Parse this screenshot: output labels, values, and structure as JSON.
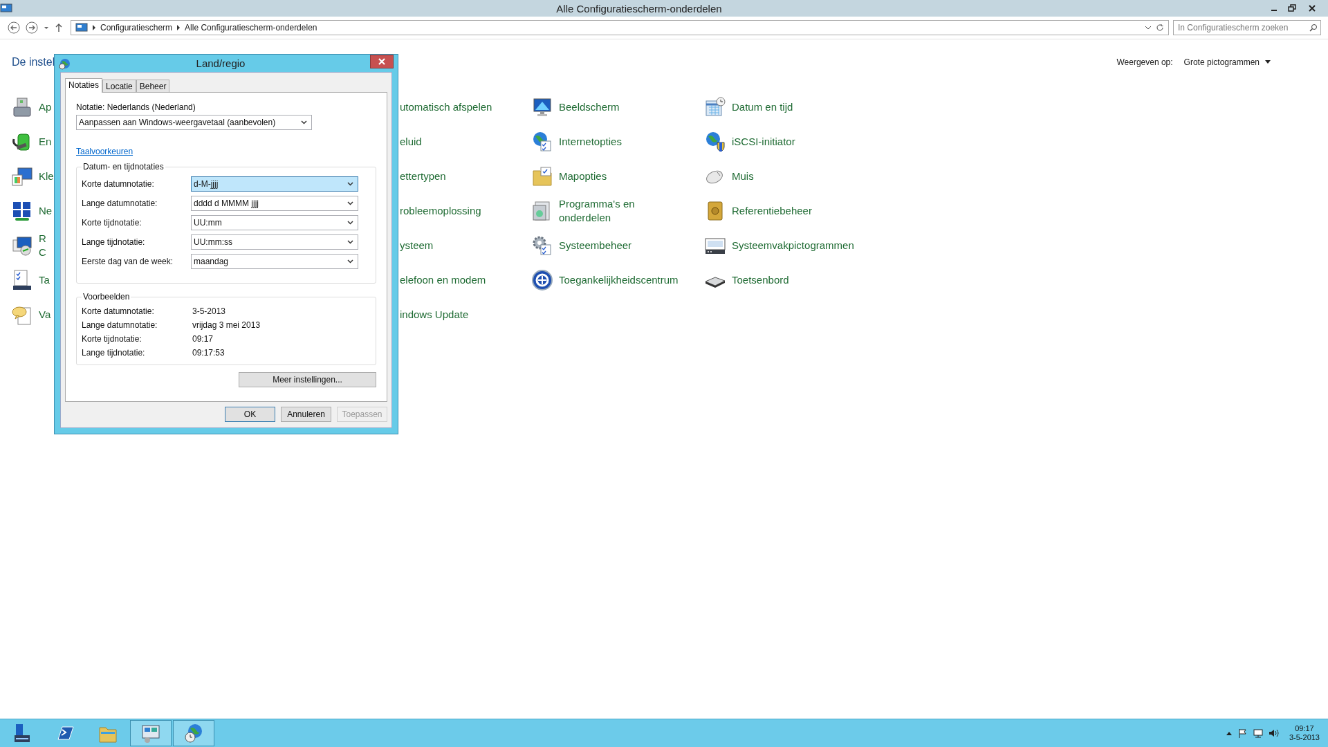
{
  "window": {
    "title": "Alle Configuratiescherm-onderdelen"
  },
  "address_bar": {
    "breadcrumbs": [
      "Configuratiescherm",
      "Alle Configuratiescherm-onderdelen"
    ]
  },
  "search": {
    "placeholder": "In Configuratiescherm zoeken"
  },
  "heading": "De instel",
  "view_by": {
    "label": "Weergeven op:",
    "value": "Grote pictogrammen"
  },
  "columns": [
    {
      "items": [
        {
          "kind": "icon",
          "lines": [
            "Ap"
          ]
        },
        {
          "kind": "icon",
          "lines": [
            "En"
          ]
        },
        {
          "kind": "icon",
          "lines": [
            "Kle"
          ]
        },
        {
          "kind": "icon",
          "lines": [
            "Ne"
          ]
        },
        {
          "kind": "icon",
          "lines": [
            "R",
            "C"
          ]
        },
        {
          "kind": "icon",
          "lines": [
            "Ta"
          ]
        },
        {
          "kind": "icon",
          "lines": [
            "Va"
          ]
        }
      ]
    },
    {
      "items": [
        {
          "kind": "text",
          "lines": [
            "utomatisch afspelen"
          ]
        },
        {
          "kind": "text",
          "lines": [
            "eluid"
          ]
        },
        {
          "kind": "text",
          "lines": [
            "ettertypen"
          ]
        },
        {
          "kind": "text",
          "lines": [
            "robleemoplossing"
          ]
        },
        {
          "kind": "text",
          "lines": [
            "ysteem"
          ]
        },
        {
          "kind": "text",
          "lines": [
            "elefoon en modem"
          ]
        },
        {
          "kind": "text",
          "lines": [
            "indows Update"
          ]
        }
      ]
    },
    {
      "items": [
        {
          "kind": "icon",
          "lines": [
            "Beeldscherm"
          ]
        },
        {
          "kind": "icon",
          "lines": [
            "Internetopties"
          ]
        },
        {
          "kind": "icon",
          "lines": [
            "Mapopties"
          ]
        },
        {
          "kind": "icon",
          "lines": [
            "Programma's en",
            "onderdelen"
          ]
        },
        {
          "kind": "icon",
          "lines": [
            "Systeembeheer"
          ]
        },
        {
          "kind": "icon",
          "lines": [
            "Toegankelijkheidscentrum"
          ]
        }
      ]
    },
    {
      "items": [
        {
          "kind": "icon",
          "lines": [
            "Datum en tijd"
          ]
        },
        {
          "kind": "icon",
          "lines": [
            "iSCSI-initiator"
          ]
        },
        {
          "kind": "icon",
          "lines": [
            "Muis"
          ]
        },
        {
          "kind": "icon",
          "lines": [
            "Referentiebeheer"
          ]
        },
        {
          "kind": "icon",
          "lines": [
            "Systeemvakpictogrammen"
          ]
        },
        {
          "kind": "icon",
          "lines": [
            "Toetsenbord"
          ]
        }
      ]
    }
  ],
  "dialog": {
    "title": "Land/regio",
    "tabs": [
      {
        "label": "Notaties",
        "selected": true
      },
      {
        "label": "Locatie",
        "selected": false
      },
      {
        "label": "Beheer",
        "selected": false
      }
    ],
    "format_label": "Notatie: Nederlands (Nederland)",
    "format_value": "Aanpassen aan Windows-weergavetaal (aanbevolen)",
    "link": "Taalvoorkeuren",
    "formats_group": {
      "title": "Datum- en tijdnotaties",
      "fields": [
        {
          "label": "Korte datumnotatie:",
          "value": "d-M-jjjj",
          "highlighted": true
        },
        {
          "label": "Lange datumnotatie:",
          "value": "dddd d MMMM jjjj",
          "highlighted": false
        },
        {
          "label": "Korte tijdnotatie:",
          "value": "UU:mm",
          "highlighted": false
        },
        {
          "label": "Lange tijdnotatie:",
          "value": "UU:mm:ss",
          "highlighted": false
        },
        {
          "label": "Eerste dag van de week:",
          "value": "maandag",
          "highlighted": false
        }
      ]
    },
    "examples_group": {
      "title": "Voorbeelden",
      "rows": [
        {
          "label": "Korte datumnotatie:",
          "value": "3-5-2013"
        },
        {
          "label": "Lange datumnotatie:",
          "value": "vrijdag 3 mei 2013"
        },
        {
          "label": "Korte tijdnotatie:",
          "value": "09:17"
        },
        {
          "label": "Lange tijdnotatie:",
          "value": "09:17:53"
        }
      ]
    },
    "more_button": "Meer instellingen...",
    "buttons": [
      {
        "label": "OK",
        "disabled": false
      },
      {
        "label": "Annuleren",
        "disabled": false
      },
      {
        "label": "Toepassen",
        "disabled": true
      }
    ]
  },
  "taskbar": {
    "apps": [
      {
        "open": false
      },
      {
        "open": false
      },
      {
        "open": false
      },
      {
        "open": true
      },
      {
        "open": true
      }
    ]
  },
  "clock": {
    "time": "09:17",
    "date": "3-5-2013"
  }
}
